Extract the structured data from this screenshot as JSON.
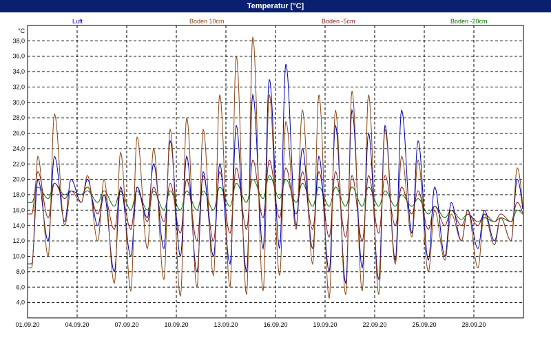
{
  "chart_data": {
    "type": "line",
    "title": "Temperatur [°C]",
    "ylabel": "°C",
    "ylim": [
      2.0,
      40.0
    ],
    "yticks": [
      4.0,
      6.0,
      8.0,
      10.0,
      12.0,
      14.0,
      16.0,
      18.0,
      20.0,
      22.0,
      24.0,
      26.0,
      28.0,
      30.0,
      32.0,
      34.0,
      36.0,
      38.0
    ],
    "xticks": [
      "01.09.20",
      "04.09.20",
      "07.09.20",
      "10.09.20",
      "13.09.20",
      "16.09.20",
      "19.09.20",
      "22.09.20",
      "25.09.20",
      "28.09.20"
    ],
    "x_range_days": [
      0,
      30
    ],
    "grid": true,
    "legend_position": "top",
    "series": [
      {
        "name": "Luft",
        "color": "#0000b0",
        "daily_min": [
          9.0,
          12.0,
          14.5,
          17.0,
          14.0,
          8.0,
          10.0,
          15.0,
          11.0,
          10.0,
          8.0,
          10.0,
          9.0,
          8.0,
          11.0,
          11.0,
          14.0,
          11.0,
          8.0,
          6.5,
          8.5,
          7.0,
          9.5,
          13.0,
          9.5,
          10.0,
          12.0,
          11.0,
          12.0,
          12.0,
          13.0
        ],
        "daily_max": [
          20.0,
          23.0,
          20.0,
          20.0,
          18.0,
          19.0,
          19.0,
          22.0,
          25.0,
          23.0,
          21.0,
          22.0,
          27.0,
          31.0,
          33.0,
          35.0,
          24.0,
          23.0,
          27.0,
          29.0,
          26.0,
          27.0,
          29.0,
          25.0,
          19.0,
          17.0,
          16.0,
          16.0,
          15.0,
          20.0,
          18.0
        ]
      },
      {
        "name": "Boden 10cm",
        "color": "#8b4513",
        "daily_min": [
          8.5,
          10.0,
          14.0,
          17.0,
          12.0,
          6.5,
          5.5,
          11.0,
          7.0,
          4.8,
          6.0,
          7.5,
          6.0,
          5.0,
          5.5,
          7.5,
          13.5,
          9.0,
          4.5,
          5.0,
          5.5,
          5.0,
          9.0,
          12.5,
          8.0,
          9.5,
          12.0,
          8.5,
          11.5,
          12.0,
          12.5
        ],
        "daily_max": [
          23.0,
          28.5,
          18.5,
          20.5,
          20.0,
          23.5,
          25.5,
          24.0,
          26.5,
          28.0,
          26.5,
          31.0,
          36.0,
          38.5,
          31.0,
          27.5,
          29.0,
          31.0,
          29.0,
          31.5,
          31.0,
          26.5,
          23.0,
          22.5,
          16.0,
          15.5,
          16.0,
          15.5,
          15.0,
          21.5,
          16.5
        ]
      },
      {
        "name": "Boden -5cm",
        "color": "#8b1a1a",
        "daily_min": [
          15.5,
          15.0,
          17.5,
          18.0,
          15.5,
          13.5,
          13.5,
          14.5,
          14.5,
          13.0,
          12.0,
          12.0,
          13.0,
          13.5,
          15.0,
          15.0,
          15.5,
          13.5,
          12.5,
          12.5,
          12.0,
          13.0,
          14.0,
          15.5,
          13.5,
          14.0,
          14.0,
          14.0,
          14.5,
          14.5,
          14.5
        ],
        "daily_max": [
          21.0,
          19.5,
          18.5,
          19.0,
          18.0,
          18.5,
          19.0,
          19.0,
          19.5,
          20.0,
          20.5,
          21.0,
          21.5,
          22.5,
          22.5,
          21.5,
          21.0,
          21.0,
          21.0,
          20.5,
          20.5,
          20.5,
          19.0,
          18.5,
          16.5,
          16.0,
          15.5,
          15.5,
          15.5,
          17.0,
          16.5
        ]
      },
      {
        "name": "Boden -20cm",
        "color": "#007000",
        "daily_min": [
          17.0,
          17.5,
          18.0,
          18.0,
          17.0,
          16.5,
          16.0,
          16.0,
          16.0,
          16.0,
          16.0,
          16.0,
          16.5,
          17.0,
          17.5,
          17.5,
          17.0,
          16.5,
          16.5,
          16.5,
          16.5,
          16.5,
          16.5,
          16.5,
          15.5,
          15.0,
          14.8,
          14.5,
          14.5,
          14.5,
          15.0
        ],
        "daily_max": [
          19.0,
          19.5,
          18.5,
          18.5,
          18.5,
          18.5,
          18.5,
          18.5,
          18.5,
          18.5,
          18.5,
          19.0,
          19.5,
          20.0,
          20.5,
          20.0,
          19.5,
          19.0,
          19.0,
          19.0,
          19.0,
          18.5,
          18.0,
          17.5,
          16.5,
          16.0,
          15.5,
          15.0,
          15.0,
          16.0,
          16.5
        ]
      }
    ]
  }
}
